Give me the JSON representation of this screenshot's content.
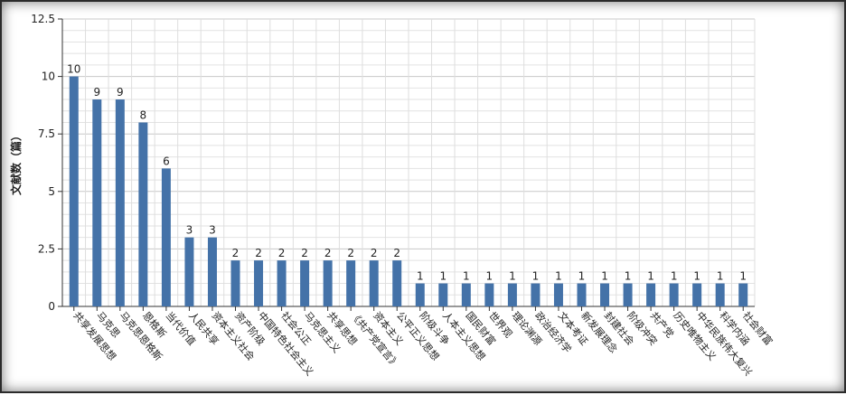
{
  "chart_data": {
    "type": "bar",
    "title": "",
    "xlabel": "",
    "ylabel": "文献数（篇）",
    "ylim": [
      0,
      12.5
    ],
    "yticks": [
      0,
      2.5,
      5,
      7.5,
      10,
      12.5
    ],
    "ytick_labels": [
      "0",
      "2.5",
      "5",
      "7.5",
      "10",
      "12.5"
    ],
    "grid": true,
    "bar_color": "#4472a8",
    "categories": [
      "共享发展思想",
      "马克思",
      "马克思恩格斯",
      "恩格斯",
      "当代价值",
      "人民共享",
      "资本主义社会",
      "资产阶级",
      "中国特色社会主义",
      "社会公正",
      "马克思主义",
      "共享思想",
      "《共产党宣言》",
      "资本主义",
      "公平正义思想",
      "阶级斗争",
      "人本主义思想",
      "国民财富",
      "世界观",
      "理论渊源",
      "政治经济学",
      "文本考证",
      "新发展理念",
      "封建社会",
      "阶级冲突",
      "共产党",
      "历史唯物主义",
      "中华民族伟大复兴",
      "科学内涵",
      "社会财富"
    ],
    "values": [
      10,
      9,
      9,
      8,
      6,
      3,
      3,
      2,
      2,
      2,
      2,
      2,
      2,
      2,
      2,
      1,
      1,
      1,
      1,
      1,
      1,
      1,
      1,
      1,
      1,
      1,
      1,
      1,
      1,
      1
    ]
  }
}
